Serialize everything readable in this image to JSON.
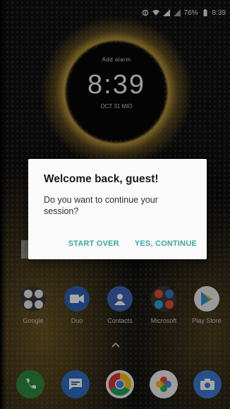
{
  "status_bar": {
    "battery_text": "76%",
    "time": "8:39"
  },
  "clock_widget": {
    "alarm_text": "Add alarm",
    "time": "8:39",
    "date": "OCT 31 MIO"
  },
  "dialog": {
    "title": "Welcome back, guest!",
    "message": "Do you want to continue your session?",
    "buttons": {
      "start_over": "START OVER",
      "continue": "YES, CONTINUE"
    },
    "accent_color": "#3aa89a"
  },
  "apps": [
    {
      "label": "Google",
      "icon": "folder-icon"
    },
    {
      "label": "Duo",
      "icon": "duo-icon"
    },
    {
      "label": "Contacts",
      "icon": "contacts-icon"
    },
    {
      "label": "Microsoft",
      "icon": "folder-icon"
    },
    {
      "label": "Play Store",
      "icon": "play-store-icon"
    }
  ],
  "dock": [
    {
      "name": "phone",
      "icon": "phone-icon"
    },
    {
      "name": "messages",
      "icon": "messages-icon"
    },
    {
      "name": "chrome",
      "icon": "chrome-icon"
    },
    {
      "name": "photos",
      "icon": "photos-icon"
    },
    {
      "name": "camera",
      "icon": "camera-icon"
    }
  ]
}
